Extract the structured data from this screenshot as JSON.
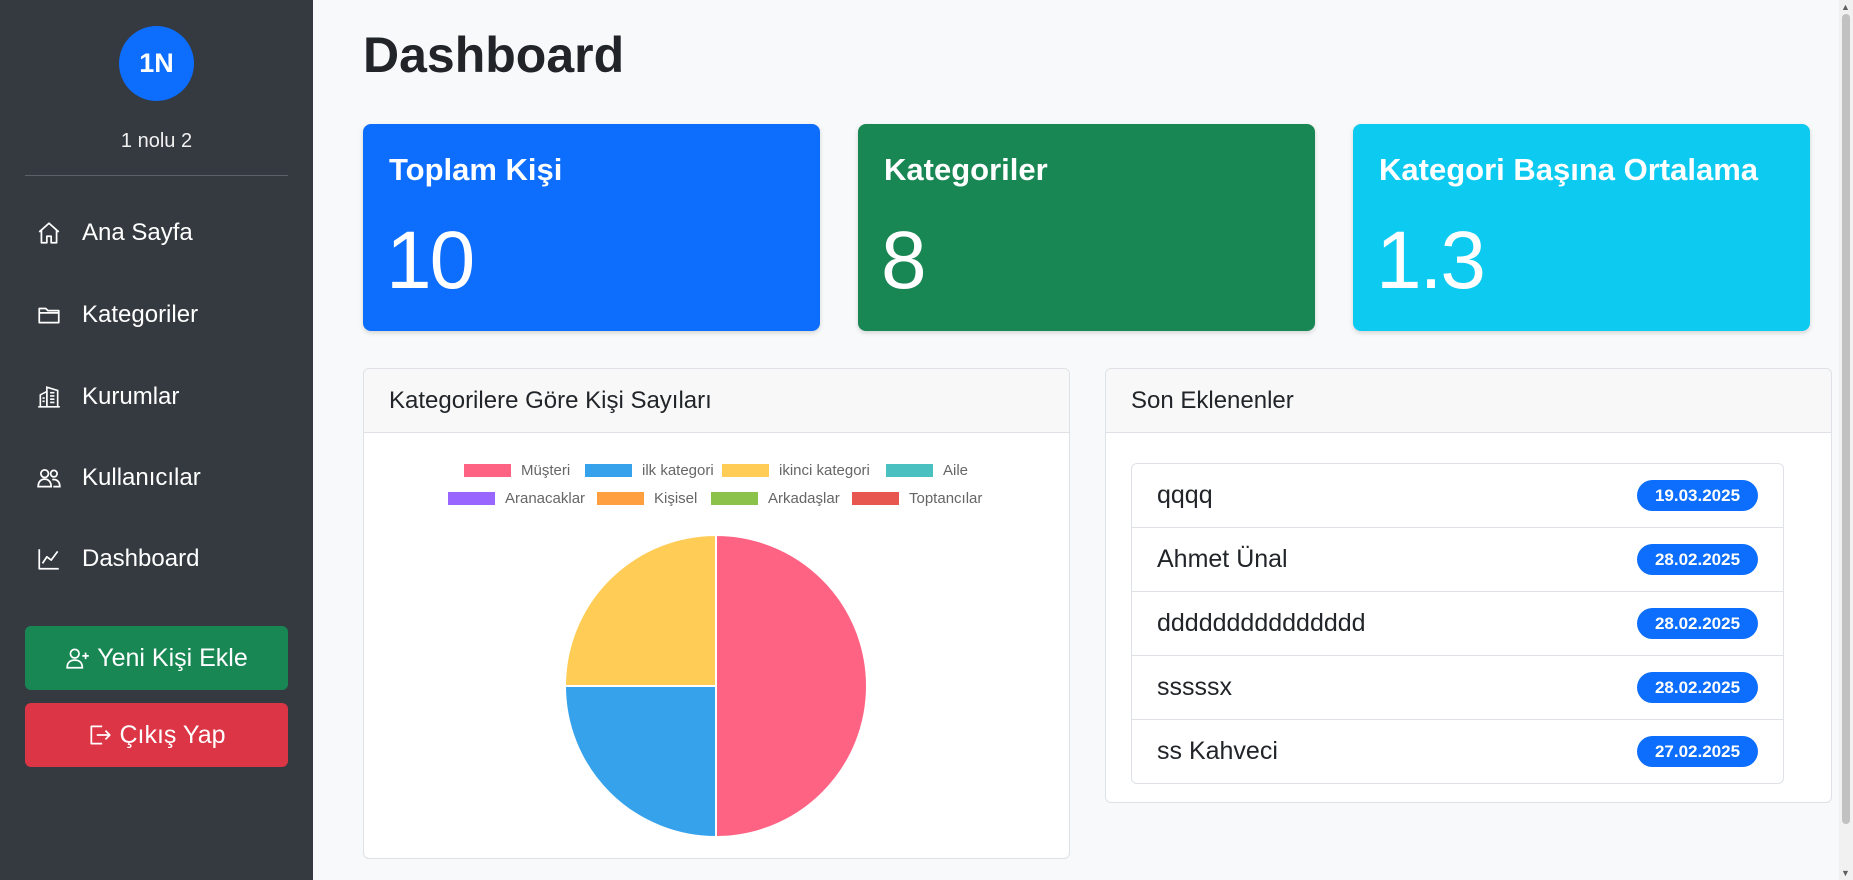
{
  "sidebar": {
    "avatar_initials": "1N",
    "username": "1 nolu 2",
    "nav": [
      {
        "label": "Ana Sayfa",
        "icon": "house-icon"
      },
      {
        "label": "Kategoriler",
        "icon": "folder-icon"
      },
      {
        "label": "Kurumlar",
        "icon": "building-icon"
      },
      {
        "label": "Kullanıcılar",
        "icon": "people-icon"
      },
      {
        "label": "Dashboard",
        "icon": "graph-icon"
      }
    ],
    "add_button": "Yeni Kişi Ekle",
    "logout_button": "Çıkış Yap"
  },
  "page_title": "Dashboard",
  "stats": [
    {
      "title": "Toplam Kişi",
      "value": "10",
      "color": "#0d6efd"
    },
    {
      "title": "Kategoriler",
      "value": "8",
      "color": "#198754"
    },
    {
      "title": "Kategori Başına Ortalama",
      "value": "1.3",
      "color": "#0dcaf0"
    }
  ],
  "chart_panel": {
    "title": "Kategorilere Göre Kişi Sayıları"
  },
  "chart_data": {
    "type": "pie",
    "title": "",
    "legend_position": "top",
    "series": [
      {
        "name": "Müşteri",
        "value": 2,
        "color": "#ff6384"
      },
      {
        "name": "ilk kategori",
        "value": 1,
        "color": "#36a2eb"
      },
      {
        "name": "ikinci kategori",
        "value": 1,
        "color": "#ffcd56"
      },
      {
        "name": "Aile",
        "value": 0,
        "color": "#4bc0c0"
      },
      {
        "name": "Aranacaklar",
        "value": 0,
        "color": "#9966ff"
      },
      {
        "name": "Kişisel",
        "value": 0,
        "color": "#ff9f40"
      },
      {
        "name": "Arkadaşlar",
        "value": 0,
        "color": "#8bc34a"
      },
      {
        "name": "Toptancılar",
        "value": 0,
        "color": "#e8574f"
      }
    ]
  },
  "recent_panel": {
    "title": "Son Eklenenler",
    "items": [
      {
        "name": "qqqq",
        "date": "19.03.2025"
      },
      {
        "name": "Ahmet Ünal",
        "date": "28.02.2025"
      },
      {
        "name": "ddddddddddddddd",
        "date": "28.02.2025"
      },
      {
        "name": "sssssx",
        "date": "28.02.2025"
      },
      {
        "name": "ss Kahveci",
        "date": "27.02.2025"
      }
    ]
  }
}
